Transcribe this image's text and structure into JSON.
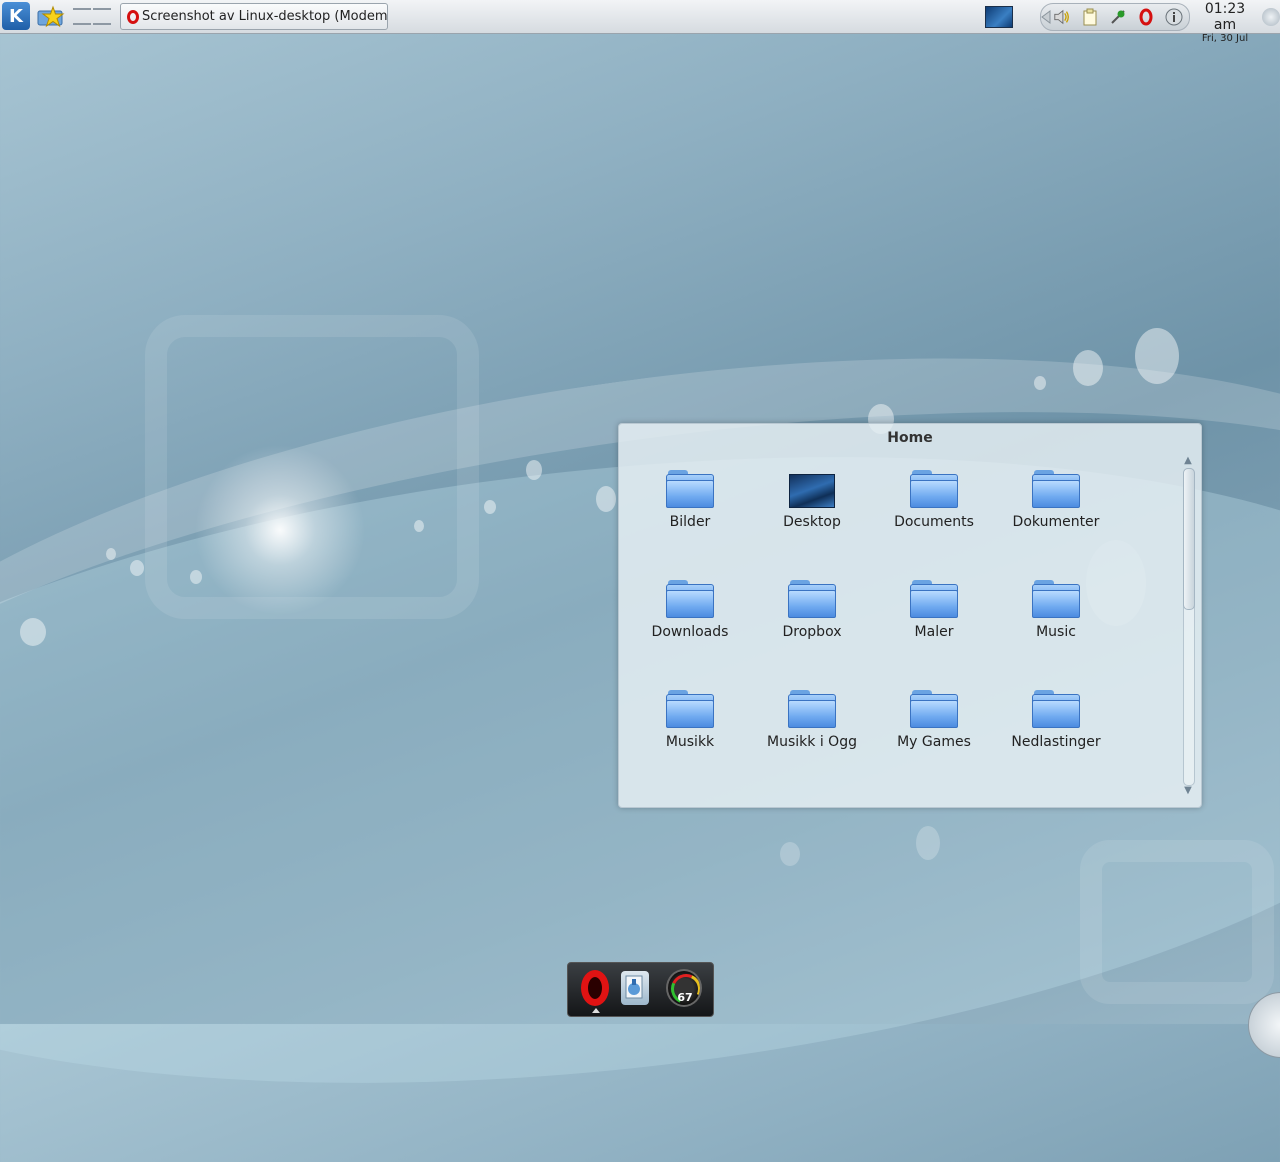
{
  "panel": {
    "kmenu_label": "K",
    "task": {
      "title": "Screenshot av Linux-desktop (Modem V",
      "icon": "opera-icon"
    },
    "tray_icons": [
      "arrow-left-icon",
      "speaker-icon",
      "clipboard-icon",
      "network-icon",
      "opera-icon",
      "info-icon"
    ],
    "clock": {
      "time": "01:23 am",
      "date": "Fri, 30 Jul"
    }
  },
  "folderview": {
    "title": "Home",
    "items": [
      {
        "label": "Bilder",
        "icon": "folder-icon"
      },
      {
        "label": "Desktop",
        "icon": "desktop-icon"
      },
      {
        "label": "Documents",
        "icon": "folder-icon"
      },
      {
        "label": "Dokumenter",
        "icon": "folder-icon"
      },
      {
        "label": "Downloads",
        "icon": "folder-icon"
      },
      {
        "label": "Dropbox",
        "icon": "folder-icon"
      },
      {
        "label": "Maler",
        "icon": "folder-icon"
      },
      {
        "label": "Music",
        "icon": "folder-icon"
      },
      {
        "label": "Musikk",
        "icon": "folder-icon"
      },
      {
        "label": "Musikk i Ogg",
        "icon": "folder-icon"
      },
      {
        "label": "My Games",
        "icon": "folder-icon"
      },
      {
        "label": "Nedlastinger",
        "icon": "folder-icon"
      }
    ]
  },
  "dock": {
    "items": [
      "opera-icon",
      "utility-icon",
      "gauge-icon"
    ],
    "gauge_value": "67"
  },
  "colors": {
    "panel": "#e2e6ea",
    "folder": "#5b9ae8",
    "opera_red": "#e01313"
  }
}
